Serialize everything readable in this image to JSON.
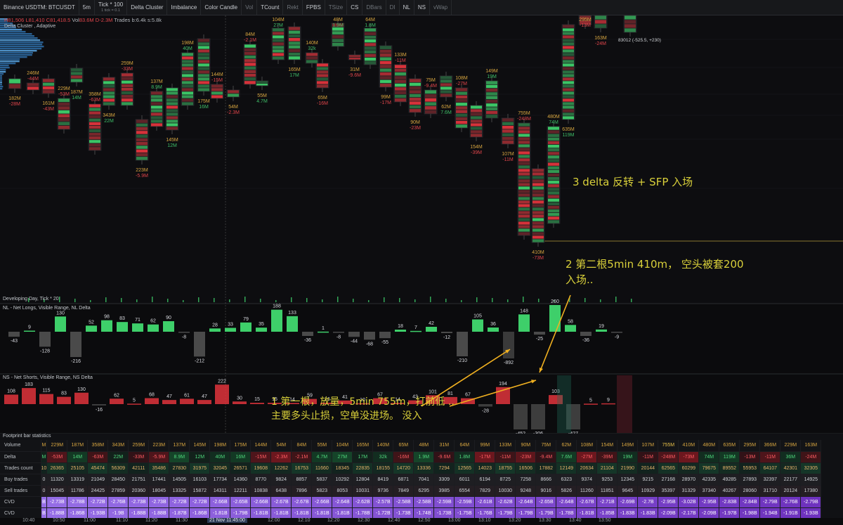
{
  "toolbar": {
    "symbol": "Binance USDTM: BTCUSDT",
    "interval": "5m",
    "tick": "Tick * 100",
    "tick_sub": "1 tick = 0.1",
    "study": "Delta Cluster",
    "mode": "Imbalance",
    "candle": "Color Candle",
    "toggles": [
      "Vol",
      "TCount",
      "Rekt",
      "FPBS",
      "TSize",
      "CS",
      "DBars",
      "DI",
      "NL",
      "NS",
      "vWap"
    ],
    "dim_toggles": [
      "Vol",
      "Rekt",
      "TSize",
      "DBars",
      "DI",
      "vWap"
    ]
  },
  "ohlc": {
    "h": "H81,506",
    "l": "L81,410",
    "c": "C81,418.5",
    "vol_label": "Vol",
    "vol": "83.6M",
    "delta": "D-2.3M",
    "trades": "Trades b:6.4k s:5.8k"
  },
  "study_label": "Delta Cluster , Adaptive",
  "price_tag": "83012 (-525.5, +230)",
  "dev_day_label": "Developing Day, Tick * 20",
  "nl_title": "NL - Net Longs, Visible Range, NL Delta",
  "ns_title": "NS - Net Shorts, Visible Range, NS Delta",
  "stats_title": "Footprint bar statistics",
  "annotations": {
    "a1_line1": "1 第一根，放量，5min 755m，打前低 ..",
    "a1_line2": "主要多头止损，空单没进场。 没入",
    "a2_line1": "2  第二根5min 410m， 空头被套200",
    "a2_line2": "入场..",
    "a3": "3 delta 反转 + SFP 入场"
  },
  "candle_labels": [
    {
      "vol": "182M",
      "d": "-28M"
    },
    {
      "vol": "246M",
      "d": "-44M"
    },
    {
      "vol": "161M",
      "d": "-43M"
    },
    {
      "vol": "229M",
      "d": "-53M"
    },
    {
      "vol": "187M",
      "d": "14M"
    },
    {
      "vol": "358M",
      "d": "-63M"
    },
    {
      "vol": "343M",
      "d": "22M"
    },
    {
      "vol": "259M",
      "d": "-33M"
    },
    {
      "vol": "223M",
      "d": "-5.9M"
    },
    {
      "vol": "137M",
      "d": "8.9M"
    },
    {
      "vol": "145M",
      "d": "12M"
    },
    {
      "vol": "198M",
      "d": "40M"
    },
    {
      "vol": "175M",
      "d": "16M"
    },
    {
      "vol": "144M",
      "d": "-15M"
    },
    {
      "vol": "54M",
      "d": "-2.3M"
    },
    {
      "vol": "84M",
      "d": "-2.1M"
    },
    {
      "vol": "55M",
      "d": "4.7M"
    },
    {
      "vol": "104M",
      "d": "27M"
    },
    {
      "vol": "165M",
      "d": "17M"
    },
    {
      "vol": "140M",
      "d": "32k"
    },
    {
      "vol": "65M",
      "d": "-16M"
    },
    {
      "vol": "48M",
      "d": "1.9M"
    },
    {
      "vol": "31M",
      "d": "-9.6M"
    },
    {
      "vol": "64M",
      "d": "1.8M"
    },
    {
      "vol": "99M",
      "d": "-17M"
    },
    {
      "vol": "133M",
      "d": "-11M"
    },
    {
      "vol": "90M",
      "d": "-23M"
    },
    {
      "vol": "75M",
      "d": "-9.4M"
    },
    {
      "vol": "62M",
      "d": "7.6M"
    },
    {
      "vol": "108M",
      "d": "-27M"
    },
    {
      "vol": "154M",
      "d": "-39M"
    },
    {
      "vol": "149M",
      "d": "19M"
    },
    {
      "vol": "107M",
      "d": "-11M"
    },
    {
      "vol": "755M",
      "d": "-248M"
    },
    {
      "vol": "410M",
      "d": "-73M"
    },
    {
      "vol": "480M",
      "d": "74M"
    },
    {
      "vol": "635M",
      "d": "119M"
    },
    {
      "vol": "295M",
      "d": "-13M"
    },
    {
      "vol": "163M",
      "d": "-24M"
    }
  ],
  "nl_values": [
    "-43",
    "9",
    "-128",
    "130",
    "-216",
    "52",
    "98",
    "83",
    "71",
    "62",
    "90",
    "-8",
    "-212",
    "28",
    "33",
    "79",
    "35",
    "188",
    "133",
    "-36",
    "1",
    "-8",
    "-44",
    "-68",
    "-55",
    "18",
    "7",
    "42",
    "-12",
    "-210",
    "105",
    "36",
    "-892",
    "148",
    "-25",
    "260",
    "58",
    "-36",
    "19",
    "-9"
  ],
  "ns_values": [
    "108",
    "183",
    "115",
    "83",
    "130",
    "-16",
    "62",
    "5",
    "68",
    "47",
    "61",
    "47",
    "222",
    "30",
    "15",
    "15",
    "14",
    "59",
    "16",
    "41",
    "10",
    "67",
    "14",
    "43",
    "101",
    "81",
    "67",
    "-28",
    "194",
    "-452",
    "-306",
    "103",
    "-427",
    "5",
    "9"
  ],
  "stats": {
    "row_labels": [
      "Volume",
      "Delta",
      "Trades count",
      "Buy trades",
      "Sell trades",
      "CVD",
      "CVD"
    ],
    "volume": [
      "M",
      "229M",
      "187M",
      "358M",
      "343M",
      "259M",
      "223M",
      "137M",
      "145M",
      "198M",
      "175M",
      "144M",
      "54M",
      "84M",
      "55M",
      "104M",
      "165M",
      "140M",
      "65M",
      "48M",
      "31M",
      "64M",
      "99M",
      "133M",
      "90M",
      "75M",
      "62M",
      "108M",
      "154M",
      "149M",
      "107M",
      "755M",
      "410M",
      "480M",
      "635M",
      "295M",
      "366M",
      "229M",
      "163M"
    ],
    "delta": [
      "M",
      "-53M",
      "14M",
      "-63M",
      "22M",
      "-33M",
      "-5.9M",
      "8.9M",
      "12M",
      "40M",
      "16M",
      "-15M",
      "-2.3M",
      "-2.1M",
      "4.7M",
      "27M",
      "17M",
      "32k",
      "-16M",
      "1.9M",
      "-9.6M",
      "1.8M",
      "-17M",
      "-11M",
      "-23M",
      "-9.4M",
      "7.6M",
      "-27M",
      "-39M",
      "19M",
      "-11M",
      "-248M",
      "-73M",
      "74M",
      "119M",
      "-13M",
      "-11M",
      "36M",
      "-24M"
    ],
    "trades_count": [
      "10",
      "26365",
      "25105",
      "45474",
      "56309",
      "42111",
      "35486",
      "27830",
      "31975",
      "32045",
      "26571",
      "19608",
      "12262",
      "16753",
      "11660",
      "18345",
      "22835",
      "18155",
      "14720",
      "13336",
      "7294",
      "12565",
      "14023",
      "18755",
      "16506",
      "17882",
      "12149",
      "20634",
      "21104",
      "21990",
      "20144",
      "62565",
      "60299",
      "79675",
      "89552",
      "55953",
      "64107",
      "42301",
      "32305"
    ],
    "buy_trades": [
      "0",
      "11320",
      "13319",
      "21049",
      "28450",
      "21751",
      "17441",
      "14505",
      "16103",
      "17734",
      "14360",
      "8770",
      "9824",
      "8857",
      "5837",
      "10292",
      "12804",
      "8419",
      "6871",
      "7041",
      "3309",
      "6011",
      "6194",
      "8725",
      "7258",
      "8666",
      "6323",
      "9374",
      "9253",
      "12345",
      "9215",
      "27168",
      "28970",
      "42335",
      "49285",
      "27893",
      "32397",
      "22177",
      "14925"
    ],
    "sell_trades": [
      "0",
      "15045",
      "11786",
      "24425",
      "27859",
      "20360",
      "18045",
      "13325",
      "15872",
      "14311",
      "12211",
      "10838",
      "6438",
      "7896",
      "5823",
      "8053",
      "10031",
      "9736",
      "7849",
      "6295",
      "3985",
      "6554",
      "7829",
      "10030",
      "9248",
      "9016",
      "5826",
      "11260",
      "11851",
      "9645",
      "10929",
      "35397",
      "31329",
      "37340",
      "40267",
      "28060",
      "31710",
      "20124",
      "17380"
    ],
    "cvd1": [
      "B",
      "-2.73B",
      "-2.78B",
      "-2.72B",
      "-2.76B",
      "-2.73B",
      "-2.73B",
      "-2.72B",
      "-2.72B",
      "-2.66B",
      "-2.65B",
      "-2.66B",
      "-2.67B",
      "-2.67B",
      "-2.66B",
      "-2.64B",
      "-2.62B",
      "-2.57B",
      "-2.58B",
      "-2.58B",
      "-2.59B",
      "-2.59B",
      "-2.61B",
      "-2.62B",
      "-2.64B",
      "-2.65B",
      "-2.64B",
      "-2.67B",
      "-2.71B",
      "-2.69B",
      "-2.7B",
      "-2.95B",
      "-3.02B",
      "-2.95B",
      "-2.83B",
      "-2.84B",
      "-2.79B",
      "-2.76B",
      "-2.79B"
    ],
    "cvd2": [
      "B",
      "-1.88B",
      "-1.86B",
      "-1.93B",
      "-1.9B",
      "-1.88B",
      "-1.88B",
      "-1.87B",
      "-1.86B",
      "-1.81B",
      "-1.79B",
      "-1.81B",
      "-1.81B",
      "-1.81B",
      "-1.81B",
      "-1.81B",
      "-1.78B",
      "-1.72B",
      "-1.73B",
      "-1.74B",
      "-1.73B",
      "-1.75B",
      "-1.76B",
      "-1.79B",
      "-1.79B",
      "-1.79B",
      "-1.78B",
      "-1.81B",
      "-1.85B",
      "-1.83B",
      "-1.83B",
      "-2.09B",
      "-2.17B",
      "-2.09B",
      "-1.97B",
      "-1.98B",
      "-1.94B",
      "-1.91B",
      "-1.93B"
    ]
  },
  "xaxis": {
    "labels": [
      "10:40",
      "10:50",
      "11:00",
      "11:10",
      "11:20",
      "11:30",
      "21 Nov 11:45:00",
      "12:00",
      "12:10",
      "12:20",
      "12:30",
      "12:40",
      "12:50",
      "13:00",
      "13:10",
      "13:20",
      "13:30",
      "13:40",
      "13:50"
    ]
  },
  "colors": {
    "bull": "#3ecf6a",
    "bear": "#e0343c",
    "annotation": "#d9d03a",
    "arrow": "#f0b020"
  }
}
